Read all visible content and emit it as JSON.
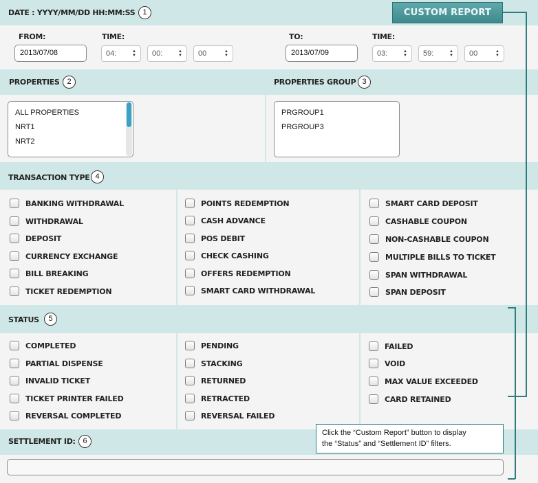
{
  "date_header": {
    "label": "DATE : YYYY/MM/DD HH:MM:SS",
    "num": "1"
  },
  "custom_report_label": "CUSTOM REPORT",
  "from": {
    "label": "FROM:",
    "date": "2013/07/08",
    "time_label": "TIME:",
    "hour": "04:",
    "minute": "00:",
    "second": "00"
  },
  "to": {
    "label": "TO:",
    "date": "2013/07/09",
    "time_label": "TIME:",
    "hour": "03:",
    "minute": "59:",
    "second": "00"
  },
  "properties": {
    "label": "PROPERTIES",
    "num": "2",
    "items": [
      "ALL PROPERTIES",
      "NRT1",
      "NRT2"
    ]
  },
  "properties_group": {
    "label": "PROPERTIES GROUP",
    "num": "3",
    "items": [
      "PRGROUP1",
      "PRGROUP3"
    ]
  },
  "transaction_type": {
    "label": "TRANSACTION TYPE",
    "num": "4",
    "col1": [
      "BANKING WITHDRAWAL",
      "WITHDRAWAL",
      "DEPOSIT",
      "CURRENCY EXCHANGE",
      "BILL BREAKING",
      "TICKET REDEMPTION"
    ],
    "col2": [
      "POINTS REDEMPTION",
      "CASH ADVANCE",
      "POS DEBIT",
      "CHECK CASHING",
      "OFFERS REDEMPTION",
      "SMART CARD WITHDRAWAL"
    ],
    "col3": [
      "SMART CARD DEPOSIT",
      "CASHABLE COUPON",
      "NON-CASHABLE COUPON",
      "MULTIPLE BILLS TO TICKET",
      "SPAN WITHDRAWAL",
      "SPAN DEPOSIT"
    ]
  },
  "status": {
    "label": "STATUS",
    "num": "5",
    "col1": [
      "COMPLETED",
      "PARTIAL DISPENSE",
      "INVALID TICKET",
      "TICKET PRINTER FAILED",
      "REVERSAL COMPLETED"
    ],
    "col2": [
      "PENDING",
      "STACKING",
      "RETURNED",
      "RETRACTED",
      "REVERSAL FAILED"
    ],
    "col3": [
      "FAILED",
      "VOID",
      "MAX VALUE EXCEEDED",
      "CARD RETAINED"
    ]
  },
  "settlement": {
    "label": "SETTLEMENT ID:",
    "num": "6",
    "value": ""
  },
  "callout": {
    "line1": "Click the “Custom Report” button to display",
    "line2": "the “Status” and “Settlement ID” filters."
  },
  "colors": {
    "band": "#cfe7e6",
    "button": "#4e9a9d",
    "scroll_thumb": "#3aa2c6",
    "connector": "#2f7c7f"
  },
  "icons": {
    "spinner": "up-down-arrows-icon",
    "checkbox": "checkbox-unchecked"
  }
}
